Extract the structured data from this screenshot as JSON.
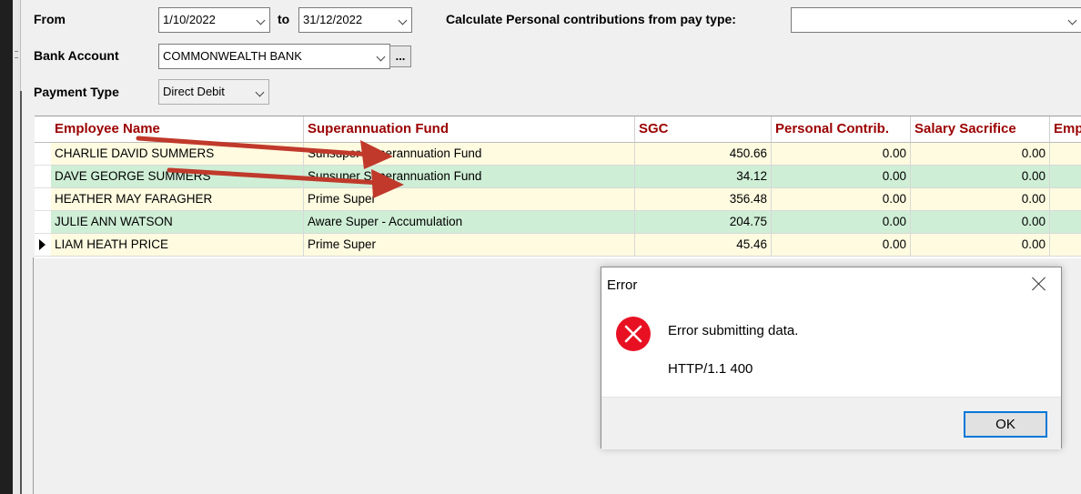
{
  "filters": {
    "from_label": "From",
    "from_date": "1/10/2022",
    "to_label": "to",
    "to_date": "31/12/2022",
    "calc_label": "Calculate Personal contributions from pay type:",
    "calc_value": "",
    "bank_label": "Bank Account",
    "bank_value": "COMMONWEALTH BANK",
    "bank_browse": "...",
    "payment_label": "Payment Type",
    "payment_value": "Direct Debit"
  },
  "table": {
    "columns": [
      "Employee Name",
      "Superannuation Fund",
      "SGC",
      "Personal Contrib.",
      "Salary Sacrifice",
      "Emp"
    ],
    "rows": [
      {
        "name": "CHARLIE DAVID SUMMERS",
        "fund": "Sunsuper Superannuation Fund",
        "sgc": "450.66",
        "personal": "0.00",
        "sacrifice": "0.00"
      },
      {
        "name": "DAVE GEORGE SUMMERS",
        "fund": "Sunsuper Superannuation Fund",
        "sgc": "34.12",
        "personal": "0.00",
        "sacrifice": "0.00"
      },
      {
        "name": "HEATHER MAY FARAGHER",
        "fund": "Prime Super",
        "sgc": "356.48",
        "personal": "0.00",
        "sacrifice": "0.00"
      },
      {
        "name": "JULIE ANN WATSON",
        "fund": "Aware Super - Accumulation",
        "sgc": "204.75",
        "personal": "0.00",
        "sacrifice": "0.00"
      },
      {
        "name": "LIAM HEATH PRICE",
        "fund": "Prime Super",
        "sgc": "45.46",
        "personal": "0.00",
        "sacrifice": "0.00"
      }
    ]
  },
  "dialog": {
    "title": "Error",
    "message": "Error submitting data.",
    "detail": "HTTP/1.1 400",
    "ok_label": "OK",
    "icon": "error-icon"
  },
  "colors": {
    "header_text": "#9b0000",
    "row_yellow": "#fffbe0",
    "row_green": "#cfeed6",
    "annotation_arrow": "#c0392b",
    "error_red": "#e81123",
    "focus_blue": "#0078d7"
  }
}
